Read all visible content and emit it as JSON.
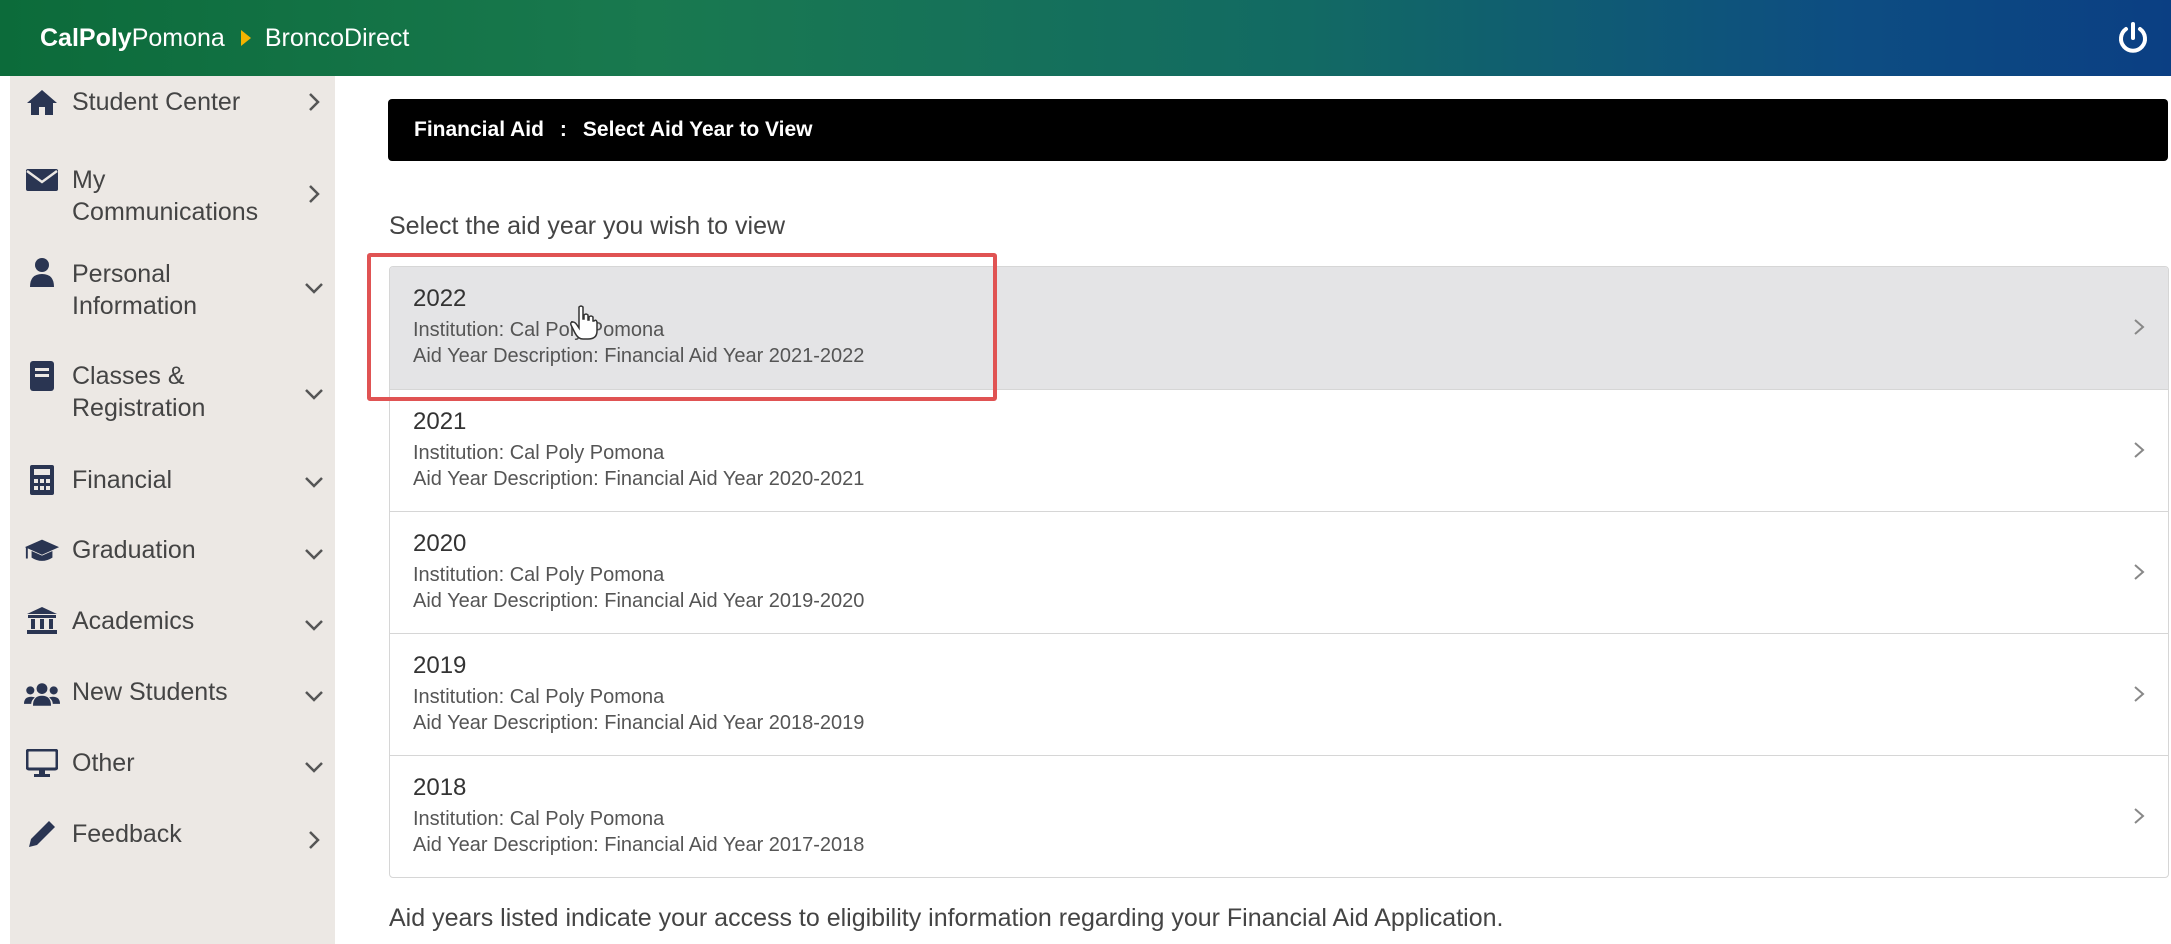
{
  "header": {
    "brand_bold": "CalPoly",
    "brand_light": "Pomona",
    "app": "BroncoDirect",
    "power_icon": "power-icon"
  },
  "sidebar": {
    "items": [
      {
        "label": "Student Center",
        "icon": "home-icon",
        "chevron": "right"
      },
      {
        "label": "My\nCommunications",
        "icon": "envelope-icon",
        "chevron": "right"
      },
      {
        "label": "Personal\nInformation",
        "icon": "user-icon",
        "chevron": "down"
      },
      {
        "label": "Classes &\nRegistration",
        "icon": "book-icon",
        "chevron": "down"
      },
      {
        "label": "Financial",
        "icon": "calculator-icon",
        "chevron": "down"
      },
      {
        "label": "Graduation",
        "icon": "graduation-cap-icon",
        "chevron": "down"
      },
      {
        "label": "Academics",
        "icon": "institution-icon",
        "chevron": "down"
      },
      {
        "label": "New Students",
        "icon": "users-icon",
        "chevron": "down"
      },
      {
        "label": "Other",
        "icon": "desktop-icon",
        "chevron": "down"
      },
      {
        "label": "Feedback",
        "icon": "pencil-icon",
        "chevron": "right"
      }
    ]
  },
  "main": {
    "title_section": "Financial Aid",
    "title_separator": ":",
    "title_page": "Select Aid Year to View",
    "prompt": "Select the aid year you wish to view",
    "aid_years": [
      {
        "year": "2022",
        "institution": "Institution: Cal Poly Pomona",
        "description": "Aid Year Description: Financial Aid Year 2021-2022"
      },
      {
        "year": "2021",
        "institution": "Institution: Cal Poly Pomona",
        "description": "Aid Year Description: Financial Aid Year 2020-2021"
      },
      {
        "year": "2020",
        "institution": "Institution: Cal Poly Pomona",
        "description": "Aid Year Description: Financial Aid Year 2019-2020"
      },
      {
        "year": "2019",
        "institution": "Institution: Cal Poly Pomona",
        "description": "Aid Year Description: Financial Aid Year 2018-2019"
      },
      {
        "year": "2018",
        "institution": "Institution: Cal Poly Pomona",
        "description": "Aid Year Description: Financial Aid Year 2017-2018"
      }
    ],
    "footnote": "Aid years listed indicate your access to eligibility information regarding your Financial Aid Application."
  },
  "colors": {
    "highlight_border": "#e05353",
    "title_bar": "#000000",
    "sidebar_bg": "#ece8e4",
    "selected_row": "#e4e4e6"
  }
}
